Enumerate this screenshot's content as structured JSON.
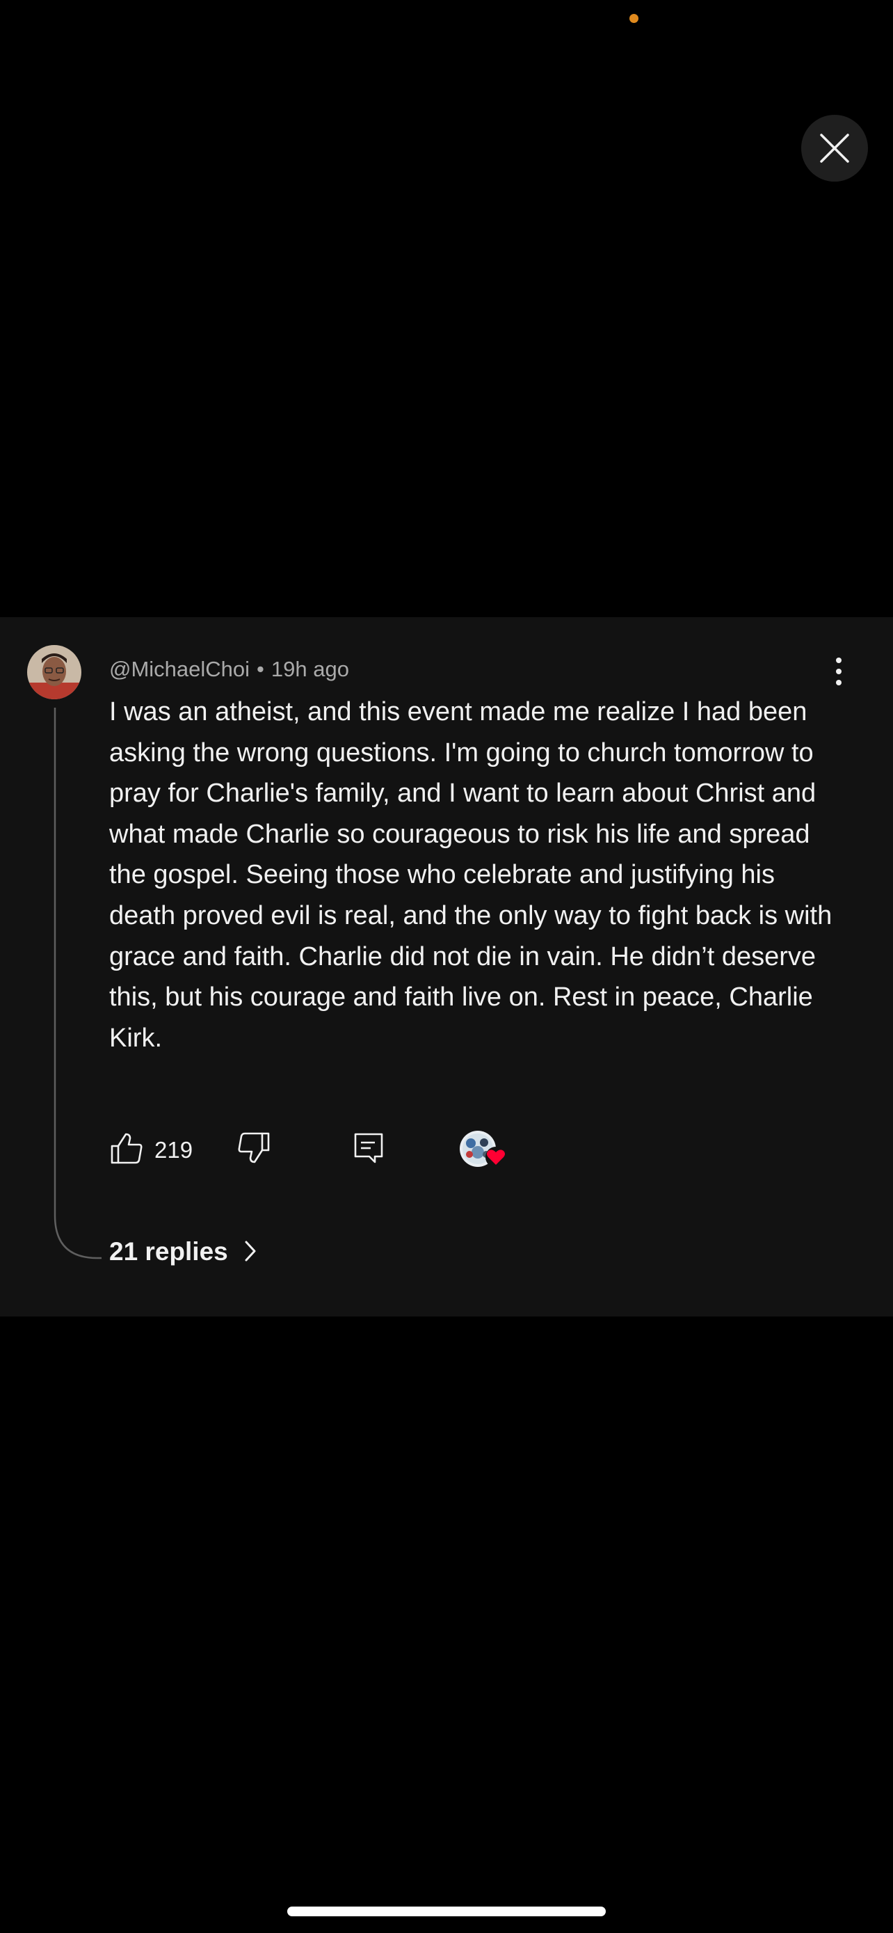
{
  "status_bar": {
    "indicator_color": "#e08a1e"
  },
  "close_button": {
    "icon": "close-icon"
  },
  "comment": {
    "author": "@MichaelChoi",
    "separator": "•",
    "time_ago": "19h ago",
    "text": "I was an atheist, and this event made me realize I had been asking the wrong questions. I'm going to church tomorrow to pray for Charlie's family, and I want to learn about Christ and what made Charlie so courageous to risk his life and spread the gospel. Seeing those who celebrate and justifying his death proved evil is real, and the only way to fight back is with grace and faith. Charlie did not die in vain. He didn’t deserve this, but his courage and faith live on. Rest in peace, Charlie Kirk.",
    "like_count": "219",
    "actions": {
      "like_icon": "thumbs-up-icon",
      "dislike_icon": "thumbs-down-icon",
      "reply_icon": "reply-comment-icon",
      "creator_heart_icon": "creator-heart-icon"
    },
    "replies_label": "21 replies"
  },
  "colors": {
    "background": "#000000",
    "card_background": "#121212",
    "text_primary": "#f1f1f1",
    "text_secondary": "#aaaaaa",
    "heart_red": "#ff0033",
    "close_button_bg": "#1f1f1f"
  }
}
